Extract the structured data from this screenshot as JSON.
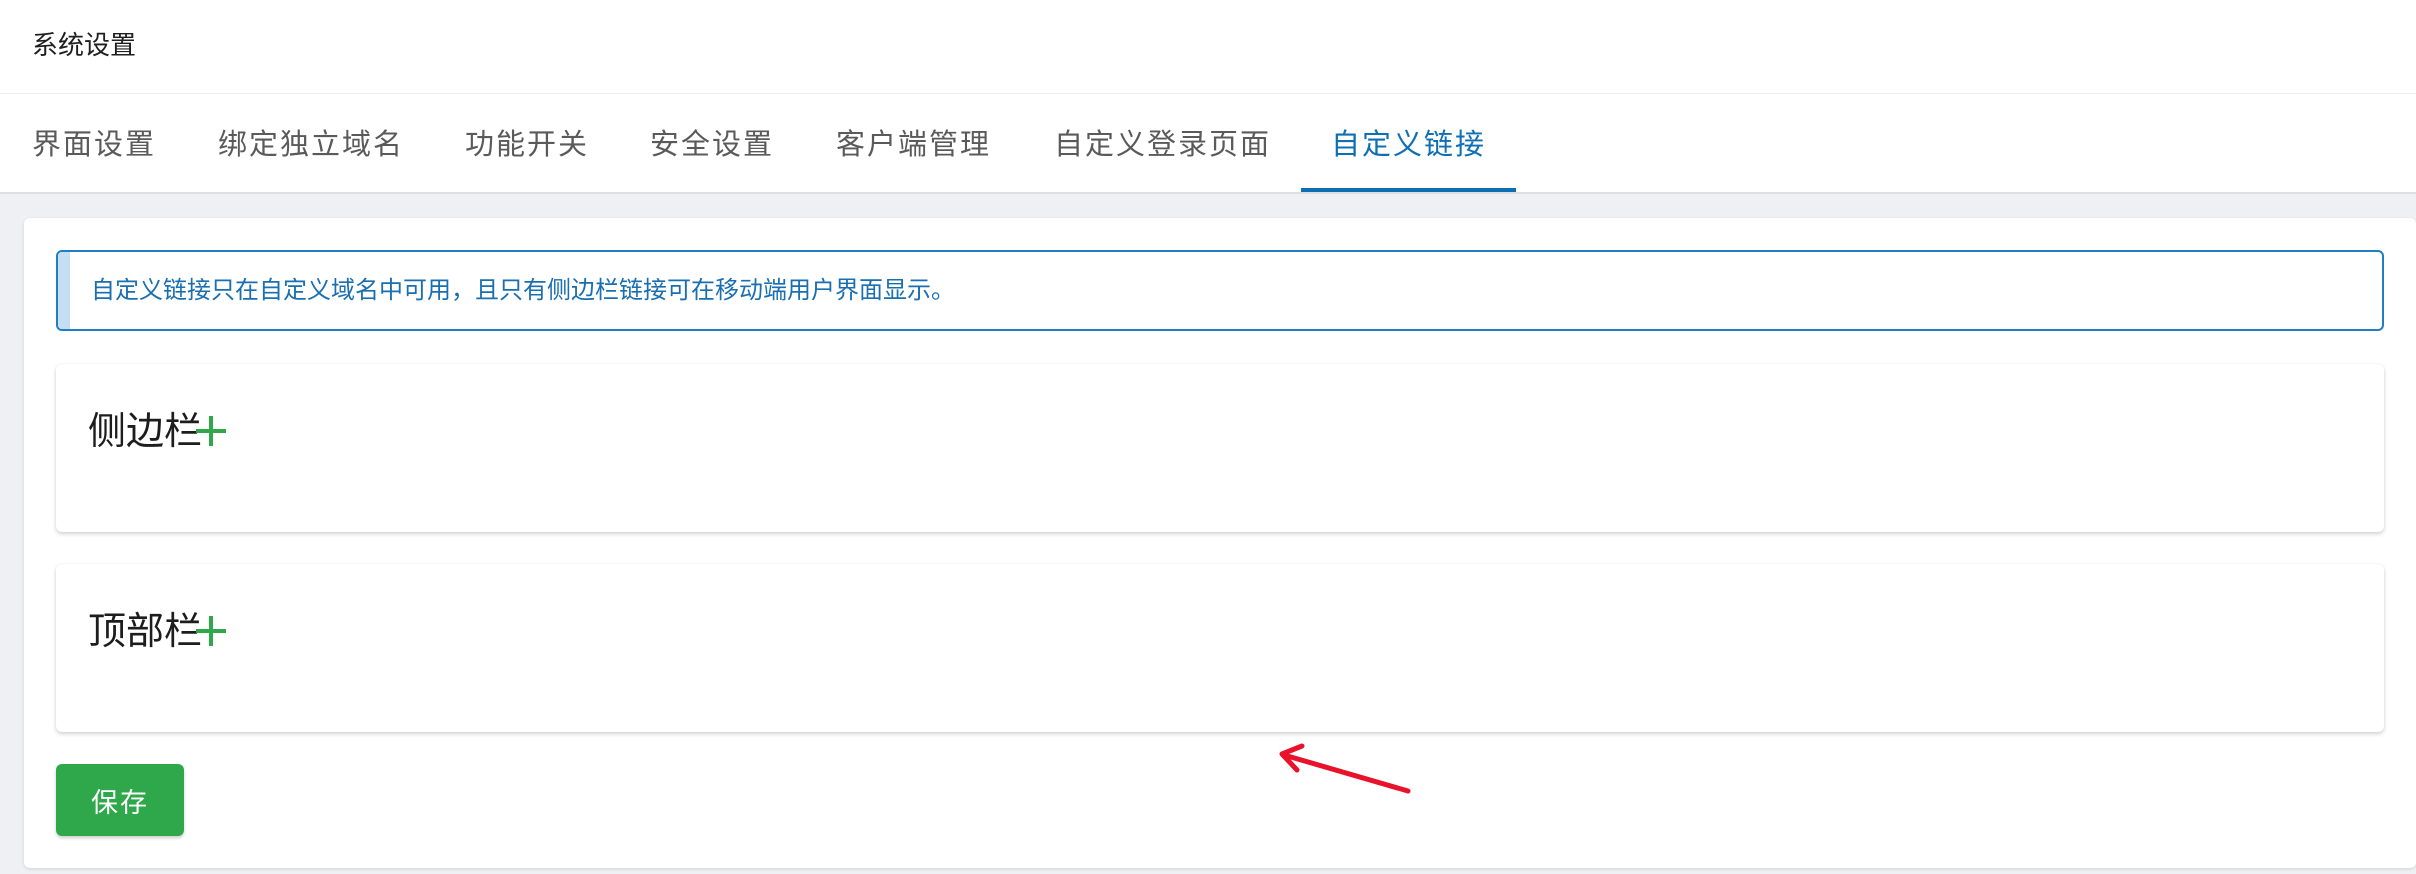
{
  "header": {
    "title": "系统设置"
  },
  "tabs": [
    {
      "label": "界面设置",
      "active": false
    },
    {
      "label": "绑定独立域名",
      "active": false
    },
    {
      "label": "功能开关",
      "active": false
    },
    {
      "label": "安全设置",
      "active": false
    },
    {
      "label": "客户端管理",
      "active": false
    },
    {
      "label": "自定义登录页面",
      "active": false
    },
    {
      "label": "自定义链接",
      "active": true
    }
  ],
  "notice": {
    "text": "自定义链接只在自定义域名中可用，且只有侧边栏链接可在移动端用户界面显示。"
  },
  "sections": [
    {
      "title": "侧边栏",
      "add_icon": "plus-icon"
    },
    {
      "title": "顶部栏",
      "add_icon": "plus-icon"
    }
  ],
  "actions": {
    "save_label": "保存"
  },
  "colors": {
    "accent": "#0f6fb3",
    "notice_border": "#1f7ec4",
    "notice_text": "#1a6fb0",
    "add_icon": "#2ea84a",
    "save_button": "#2ea84a",
    "annotation_arrow": "#e8122a"
  }
}
